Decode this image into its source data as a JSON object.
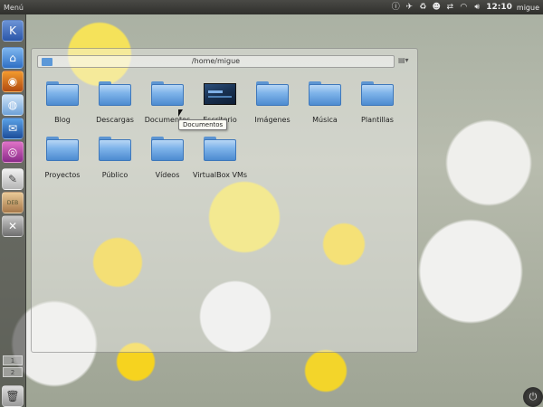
{
  "top_panel": {
    "menu_label": "Menú",
    "clock": "12:10",
    "user": "migue"
  },
  "window": {
    "path": "/home/migue"
  },
  "files": [
    {
      "name": "Blog",
      "type": "folder"
    },
    {
      "name": "Descargas",
      "type": "folder"
    },
    {
      "name": "Documentos",
      "type": "folder"
    },
    {
      "name": "Escritorio",
      "type": "desktop"
    },
    {
      "name": "Imágenes",
      "type": "folder"
    },
    {
      "name": "Música",
      "type": "folder"
    },
    {
      "name": "Plantillas",
      "type": "folder"
    },
    {
      "name": "Proyectos",
      "type": "folder"
    },
    {
      "name": "Público",
      "type": "folder"
    },
    {
      "name": "Vídeos",
      "type": "folder"
    },
    {
      "name": "VirtualBox VMs",
      "type": "folder"
    }
  ],
  "tooltip": "Documentos",
  "launcher": {
    "workspaces": [
      "1",
      "2"
    ],
    "dev_label": "DEB"
  },
  "colors": {
    "folder": "#6aa6e4",
    "panel": "#3a3a37"
  }
}
